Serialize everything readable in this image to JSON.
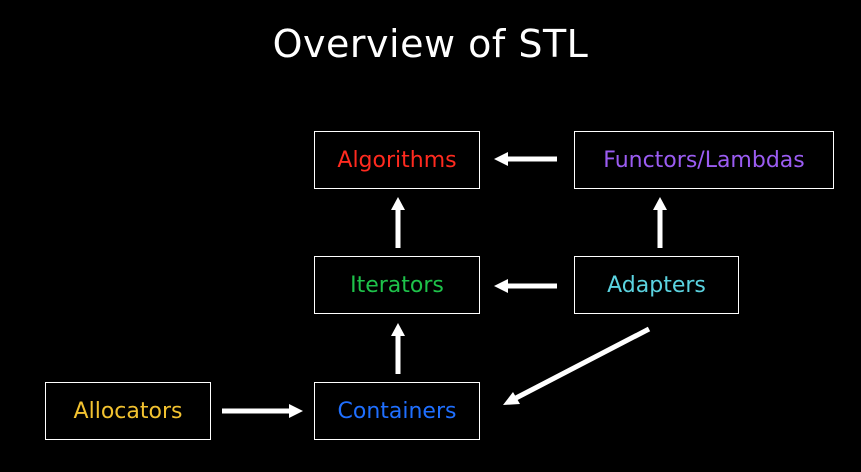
{
  "slide": {
    "title": "Overview of STL",
    "background_color": "#000000"
  },
  "nodes": {
    "algorithms": {
      "label": "Algorithms",
      "color": "#ff2a1f"
    },
    "functors": {
      "label": "Functors/Lambdas",
      "color": "#9b5cf2"
    },
    "iterators": {
      "label": "Iterators",
      "color": "#1ec24a"
    },
    "adapters": {
      "label": "Adapters",
      "color": "#5bd3e0"
    },
    "containers": {
      "label": "Containers",
      "color": "#1f6fff"
    },
    "allocators": {
      "label": "Allocators",
      "color": "#f2c230"
    }
  },
  "edges": [
    {
      "from": "functors",
      "to": "algorithms"
    },
    {
      "from": "iterators",
      "to": "algorithms"
    },
    {
      "from": "adapters",
      "to": "functors"
    },
    {
      "from": "adapters",
      "to": "iterators"
    },
    {
      "from": "containers",
      "to": "iterators"
    },
    {
      "from": "adapters",
      "to": "containers"
    },
    {
      "from": "allocators",
      "to": "containers"
    }
  ]
}
